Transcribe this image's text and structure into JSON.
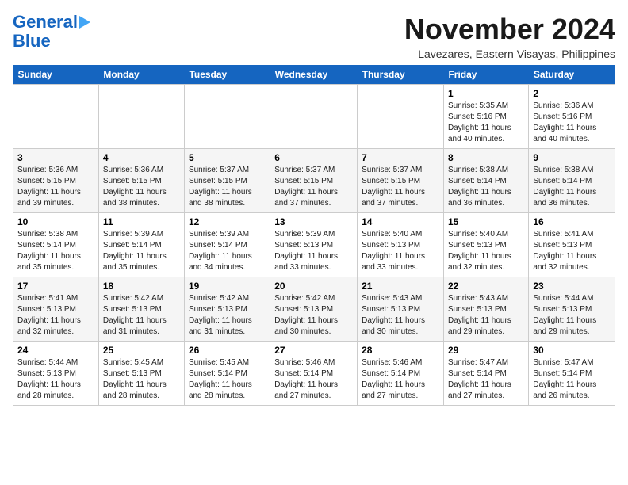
{
  "header": {
    "logo_line1": "General",
    "logo_line2": "Blue",
    "month_title": "November 2024",
    "location": "Lavezares, Eastern Visayas, Philippines"
  },
  "days_of_week": [
    "Sunday",
    "Monday",
    "Tuesday",
    "Wednesday",
    "Thursday",
    "Friday",
    "Saturday"
  ],
  "weeks": [
    [
      {
        "day": "",
        "info": ""
      },
      {
        "day": "",
        "info": ""
      },
      {
        "day": "",
        "info": ""
      },
      {
        "day": "",
        "info": ""
      },
      {
        "day": "",
        "info": ""
      },
      {
        "day": "1",
        "info": "Sunrise: 5:35 AM\nSunset: 5:16 PM\nDaylight: 11 hours and 40 minutes."
      },
      {
        "day": "2",
        "info": "Sunrise: 5:36 AM\nSunset: 5:16 PM\nDaylight: 11 hours and 40 minutes."
      }
    ],
    [
      {
        "day": "3",
        "info": "Sunrise: 5:36 AM\nSunset: 5:15 PM\nDaylight: 11 hours and 39 minutes."
      },
      {
        "day": "4",
        "info": "Sunrise: 5:36 AM\nSunset: 5:15 PM\nDaylight: 11 hours and 38 minutes."
      },
      {
        "day": "5",
        "info": "Sunrise: 5:37 AM\nSunset: 5:15 PM\nDaylight: 11 hours and 38 minutes."
      },
      {
        "day": "6",
        "info": "Sunrise: 5:37 AM\nSunset: 5:15 PM\nDaylight: 11 hours and 37 minutes."
      },
      {
        "day": "7",
        "info": "Sunrise: 5:37 AM\nSunset: 5:15 PM\nDaylight: 11 hours and 37 minutes."
      },
      {
        "day": "8",
        "info": "Sunrise: 5:38 AM\nSunset: 5:14 PM\nDaylight: 11 hours and 36 minutes."
      },
      {
        "day": "9",
        "info": "Sunrise: 5:38 AM\nSunset: 5:14 PM\nDaylight: 11 hours and 36 minutes."
      }
    ],
    [
      {
        "day": "10",
        "info": "Sunrise: 5:38 AM\nSunset: 5:14 PM\nDaylight: 11 hours and 35 minutes."
      },
      {
        "day": "11",
        "info": "Sunrise: 5:39 AM\nSunset: 5:14 PM\nDaylight: 11 hours and 35 minutes."
      },
      {
        "day": "12",
        "info": "Sunrise: 5:39 AM\nSunset: 5:14 PM\nDaylight: 11 hours and 34 minutes."
      },
      {
        "day": "13",
        "info": "Sunrise: 5:39 AM\nSunset: 5:13 PM\nDaylight: 11 hours and 33 minutes."
      },
      {
        "day": "14",
        "info": "Sunrise: 5:40 AM\nSunset: 5:13 PM\nDaylight: 11 hours and 33 minutes."
      },
      {
        "day": "15",
        "info": "Sunrise: 5:40 AM\nSunset: 5:13 PM\nDaylight: 11 hours and 32 minutes."
      },
      {
        "day": "16",
        "info": "Sunrise: 5:41 AM\nSunset: 5:13 PM\nDaylight: 11 hours and 32 minutes."
      }
    ],
    [
      {
        "day": "17",
        "info": "Sunrise: 5:41 AM\nSunset: 5:13 PM\nDaylight: 11 hours and 32 minutes."
      },
      {
        "day": "18",
        "info": "Sunrise: 5:42 AM\nSunset: 5:13 PM\nDaylight: 11 hours and 31 minutes."
      },
      {
        "day": "19",
        "info": "Sunrise: 5:42 AM\nSunset: 5:13 PM\nDaylight: 11 hours and 31 minutes."
      },
      {
        "day": "20",
        "info": "Sunrise: 5:42 AM\nSunset: 5:13 PM\nDaylight: 11 hours and 30 minutes."
      },
      {
        "day": "21",
        "info": "Sunrise: 5:43 AM\nSunset: 5:13 PM\nDaylight: 11 hours and 30 minutes."
      },
      {
        "day": "22",
        "info": "Sunrise: 5:43 AM\nSunset: 5:13 PM\nDaylight: 11 hours and 29 minutes."
      },
      {
        "day": "23",
        "info": "Sunrise: 5:44 AM\nSunset: 5:13 PM\nDaylight: 11 hours and 29 minutes."
      }
    ],
    [
      {
        "day": "24",
        "info": "Sunrise: 5:44 AM\nSunset: 5:13 PM\nDaylight: 11 hours and 28 minutes."
      },
      {
        "day": "25",
        "info": "Sunrise: 5:45 AM\nSunset: 5:13 PM\nDaylight: 11 hours and 28 minutes."
      },
      {
        "day": "26",
        "info": "Sunrise: 5:45 AM\nSunset: 5:14 PM\nDaylight: 11 hours and 28 minutes."
      },
      {
        "day": "27",
        "info": "Sunrise: 5:46 AM\nSunset: 5:14 PM\nDaylight: 11 hours and 27 minutes."
      },
      {
        "day": "28",
        "info": "Sunrise: 5:46 AM\nSunset: 5:14 PM\nDaylight: 11 hours and 27 minutes."
      },
      {
        "day": "29",
        "info": "Sunrise: 5:47 AM\nSunset: 5:14 PM\nDaylight: 11 hours and 27 minutes."
      },
      {
        "day": "30",
        "info": "Sunrise: 5:47 AM\nSunset: 5:14 PM\nDaylight: 11 hours and 26 minutes."
      }
    ]
  ]
}
